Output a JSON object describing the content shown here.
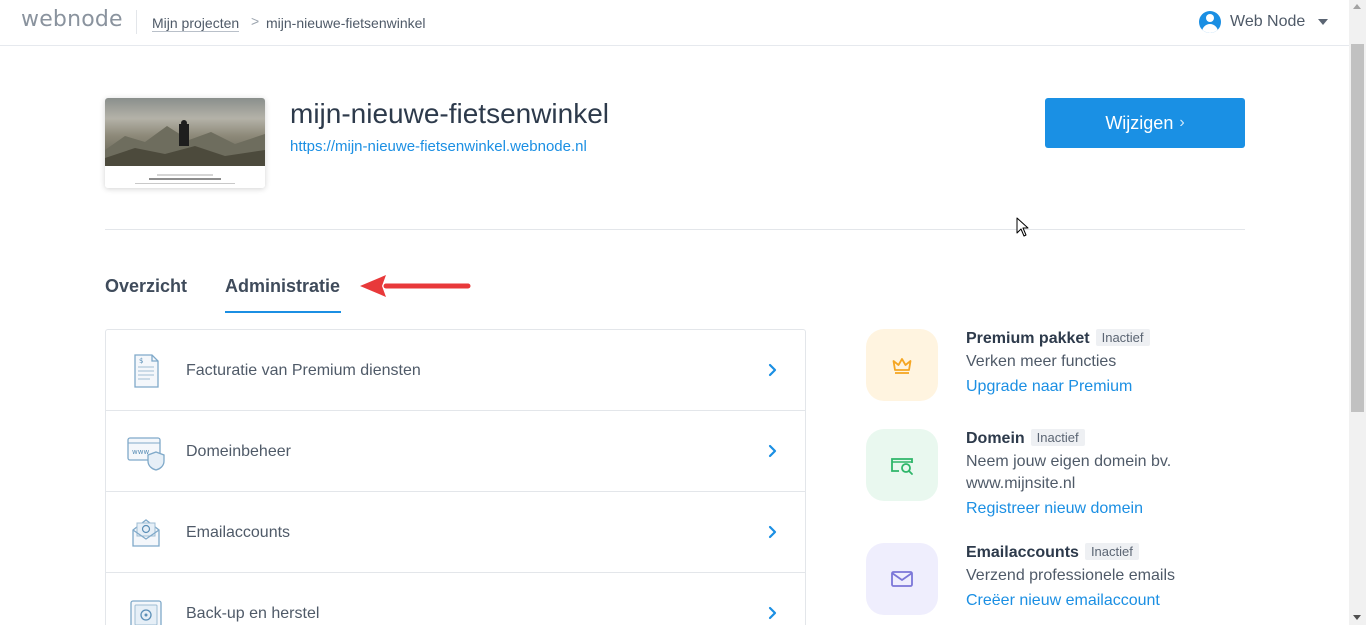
{
  "header": {
    "logo": "webnode",
    "breadcrumb": {
      "parent": "Mijn projecten",
      "separator": ">",
      "current": "mijn-nieuwe-fietsenwinkel"
    },
    "user": {
      "name": "Web Node",
      "icon": "user-avatar-icon"
    }
  },
  "project": {
    "title": "mijn-nieuwe-fietsenwinkel",
    "url": "https://mijn-nieuwe-fietsenwinkel.webnode.nl",
    "edit_button": "Wijzigen",
    "edit_chevron": "›"
  },
  "tabs": [
    {
      "label": "Overzicht",
      "active": false
    },
    {
      "label": "Administratie",
      "active": true
    }
  ],
  "admin_list": [
    {
      "label": "Facturatie van Premium diensten",
      "icon": "invoice-icon"
    },
    {
      "label": "Domeinbeheer",
      "icon": "www-shield-icon"
    },
    {
      "label": "Emailaccounts",
      "icon": "email-icon"
    },
    {
      "label": "Back-up en herstel",
      "icon": "safe-icon"
    }
  ],
  "cards": [
    {
      "title": "Premium pakket",
      "badge": "Inactief",
      "desc": "Verken meer functies",
      "link": "Upgrade naar Premium",
      "icon": "crown-icon",
      "icon_bg": "#fff4e0",
      "icon_color": "#f5a623"
    },
    {
      "title": "Domein",
      "badge": "Inactief",
      "desc": "Neem jouw eigen domein bv. www.mijnsite.nl",
      "link": "Registreer nieuw domein",
      "icon": "domain-search-icon",
      "icon_bg": "#e9f8ef",
      "icon_color": "#2fb66a"
    },
    {
      "title": "Emailaccounts",
      "badge": "Inactief",
      "desc": "Verzend professionele emails",
      "link": "Creëer nieuw emailaccount",
      "icon": "envelope-icon",
      "icon_bg": "#efeefd",
      "icon_color": "#7b76d8"
    }
  ],
  "colors": {
    "accent": "#1b8fe3",
    "annotation_arrow": "#e8393a"
  }
}
